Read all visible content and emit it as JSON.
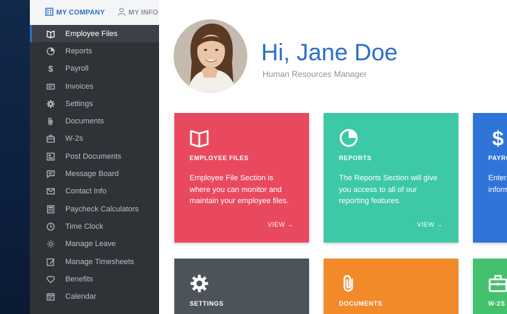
{
  "sidebar": {
    "tabs": [
      {
        "label": "MY COMPANY",
        "icon": "building-icon"
      },
      {
        "label": "MY INFO",
        "icon": "person-icon"
      }
    ],
    "items": [
      {
        "label": "Employee Files",
        "icon": "book-icon",
        "active": true
      },
      {
        "label": "Reports",
        "icon": "pie-chart-icon"
      },
      {
        "label": "Payroll",
        "icon": "dollar-icon"
      },
      {
        "label": "Invoices",
        "icon": "invoice-icon"
      },
      {
        "label": "Settings",
        "icon": "gear-icon"
      },
      {
        "label": "Documents",
        "icon": "paperclip-icon"
      },
      {
        "label": "W-2s",
        "icon": "briefcase-icon"
      },
      {
        "label": "Post Documents",
        "icon": "post-document-icon"
      },
      {
        "label": "Message Board",
        "icon": "message-icon"
      },
      {
        "label": "Contact Info",
        "icon": "envelope-icon"
      },
      {
        "label": "Paycheck Calculators",
        "icon": "calculator-icon"
      },
      {
        "label": "Time Clock",
        "icon": "clock-icon"
      },
      {
        "label": "Manage Leave",
        "icon": "sun-icon"
      },
      {
        "label": "Manage Timesheets",
        "icon": "edit-icon"
      },
      {
        "label": "Benefits",
        "icon": "heart-icon"
      },
      {
        "label": "Calendar",
        "icon": "calendar-icon"
      }
    ]
  },
  "header": {
    "greeting": "Hi, Jane Doe",
    "job_title": "Human Resources Manager"
  },
  "cards": [
    {
      "title": "EMPLOYEE FILES",
      "desc": "Employee File Section is where you can monitor and maintain your employee files.",
      "view": "VIEW →",
      "icon": "book-icon",
      "color": "#e9495f"
    },
    {
      "title": "REPORTS",
      "desc": "The Reports Section will give you access to all of our reporting features.",
      "view": "VIEW →",
      "icon": "pie-chart-icon",
      "color": "#3dc8a7"
    },
    {
      "title": "PAYRO",
      "desc": "Enter a\ninform",
      "icon": "dollar-icon",
      "color": "#2f74d8"
    },
    {
      "title": "SETTINGS",
      "icon": "gear-icon",
      "color": "#4d535a"
    },
    {
      "title": "DOCUMENTS",
      "icon": "paperclip-icon",
      "color": "#f28a2a"
    },
    {
      "title": "W-2S",
      "icon": "briefcase-icon",
      "color": "#44c16c"
    }
  ]
}
